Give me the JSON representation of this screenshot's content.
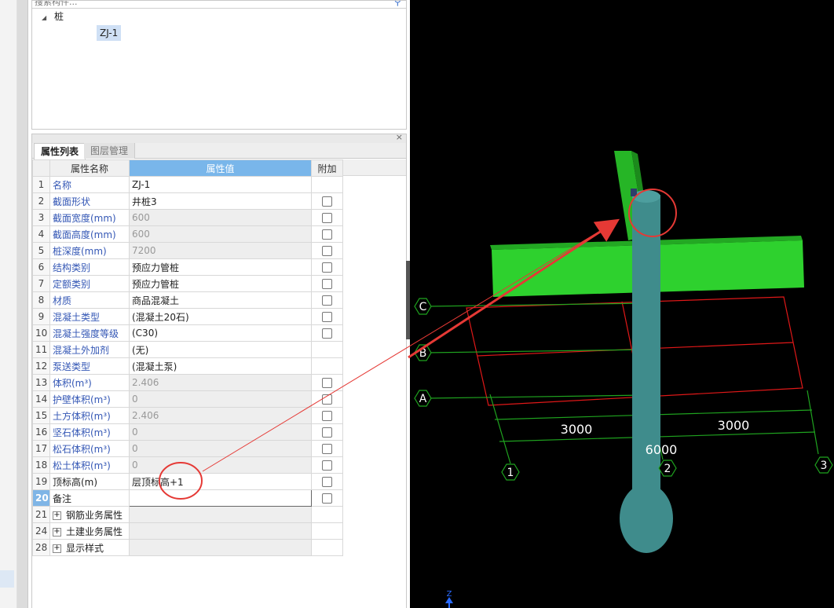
{
  "search": {
    "placeholder": "搜索构件..."
  },
  "tree": {
    "root_label": "桩",
    "items": [
      "ZJ-1"
    ]
  },
  "tabs": [
    {
      "label": "属性列表"
    },
    {
      "label": "图层管理"
    }
  ],
  "table": {
    "headers": {
      "name": "属性名称",
      "value": "属性值",
      "add": "附加"
    },
    "rows": [
      {
        "num": "1",
        "name": "名称",
        "value": "ZJ-1"
      },
      {
        "num": "2",
        "name": "截面形状",
        "value": "井桩3"
      },
      {
        "num": "3",
        "name": "截面宽度(mm)",
        "value": "600"
      },
      {
        "num": "4",
        "name": "截面高度(mm)",
        "value": "600"
      },
      {
        "num": "5",
        "name": "桩深度(mm)",
        "value": "7200"
      },
      {
        "num": "6",
        "name": "结构类别",
        "value": "预应力管桩"
      },
      {
        "num": "7",
        "name": "定额类别",
        "value": "预应力管桩"
      },
      {
        "num": "8",
        "name": "材质",
        "value": "商品混凝土"
      },
      {
        "num": "9",
        "name": "混凝土类型",
        "value": "(混凝土20石)"
      },
      {
        "num": "10",
        "name": "混凝土强度等级",
        "value": "(C30)"
      },
      {
        "num": "11",
        "name": "混凝土外加剂",
        "value": "(无)"
      },
      {
        "num": "12",
        "name": "泵送类型",
        "value": "(混凝土泵)"
      },
      {
        "num": "13",
        "name": "体积(m³)",
        "value": "2.406"
      },
      {
        "num": "14",
        "name": "护壁体积(m³)",
        "value": "0"
      },
      {
        "num": "15",
        "name": "土方体积(m³)",
        "value": "2.406"
      },
      {
        "num": "16",
        "name": "坚石体积(m³)",
        "value": "0"
      },
      {
        "num": "17",
        "name": "松石体积(m³)",
        "value": "0"
      },
      {
        "num": "18",
        "name": "松土体积(m³)",
        "value": "0"
      },
      {
        "num": "19",
        "name": "顶标高(m)",
        "value": "层顶标高+1"
      },
      {
        "num": "20",
        "name": "备注",
        "value": ""
      },
      {
        "num": "21",
        "name": "钢筋业务属性",
        "value": ""
      },
      {
        "num": "24",
        "name": "土建业务属性",
        "value": ""
      },
      {
        "num": "28",
        "name": "显示样式",
        "value": ""
      }
    ]
  },
  "viewport": {
    "axes_rows": [
      "C",
      "B",
      "A"
    ],
    "axes_cols": [
      "1",
      "2",
      "3"
    ],
    "dims": {
      "left": "3000",
      "right": "3000",
      "total": "6000"
    },
    "z_label": "Z",
    "colors": {
      "beam": "#2ed12e",
      "pile": "#3f8c8c",
      "grid": "#e01818",
      "axis": "#1fa31f",
      "annotation": "#e53935"
    }
  }
}
